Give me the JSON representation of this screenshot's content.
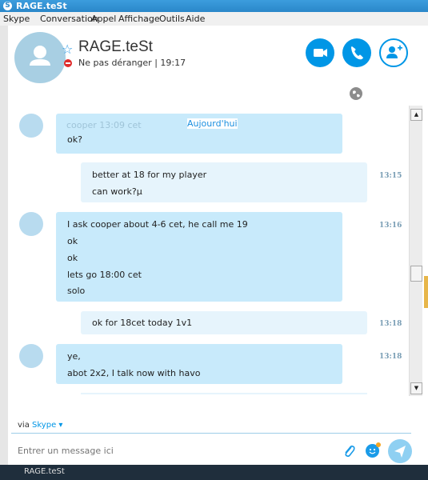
{
  "window": {
    "title": "RAGE.teSt"
  },
  "menu": [
    "Skype",
    "Conversation",
    "Appel",
    "Affichage",
    "Outils",
    "Aide"
  ],
  "contact": {
    "name": "RAGE.teSt",
    "status": "Ne pas déranger",
    "time": "19:17"
  },
  "chat": {
    "day_label": "Aujourd'hui",
    "messages": [
      {
        "direction": "in",
        "author": "cooper",
        "partial_header": "cooper     13:09 cet",
        "lines": [
          "ok?"
        ],
        "time": ""
      },
      {
        "direction": "out",
        "lines": [
          "better at 18 for my player",
          "can work?µ"
        ],
        "time": "13:15"
      },
      {
        "direction": "in",
        "lines": [
          "I ask cooper about 4-6 cet, he call me 19",
          "ok",
          "ok",
          "lets go 18:00 cet",
          "solo"
        ],
        "time": "13:16"
      },
      {
        "direction": "out",
        "lines": [
          "ok for 18cet today 1v1"
        ],
        "time": "13:18"
      },
      {
        "direction": "in",
        "lines": [
          "ye,",
          "abot 2x2, I talk now with havo"
        ],
        "time": "13:18"
      }
    ]
  },
  "composer": {
    "via_label": "via",
    "via_service": "Skype ▾",
    "placeholder": "Entrer un message ici"
  },
  "taskbar": {
    "label": "RAGE.teSt"
  },
  "colors": {
    "accent": "#0096e6",
    "incoming_bubble": "#c8eafb",
    "outgoing_bubble": "#e6f4fc",
    "busy_status": "#e02c2c"
  }
}
